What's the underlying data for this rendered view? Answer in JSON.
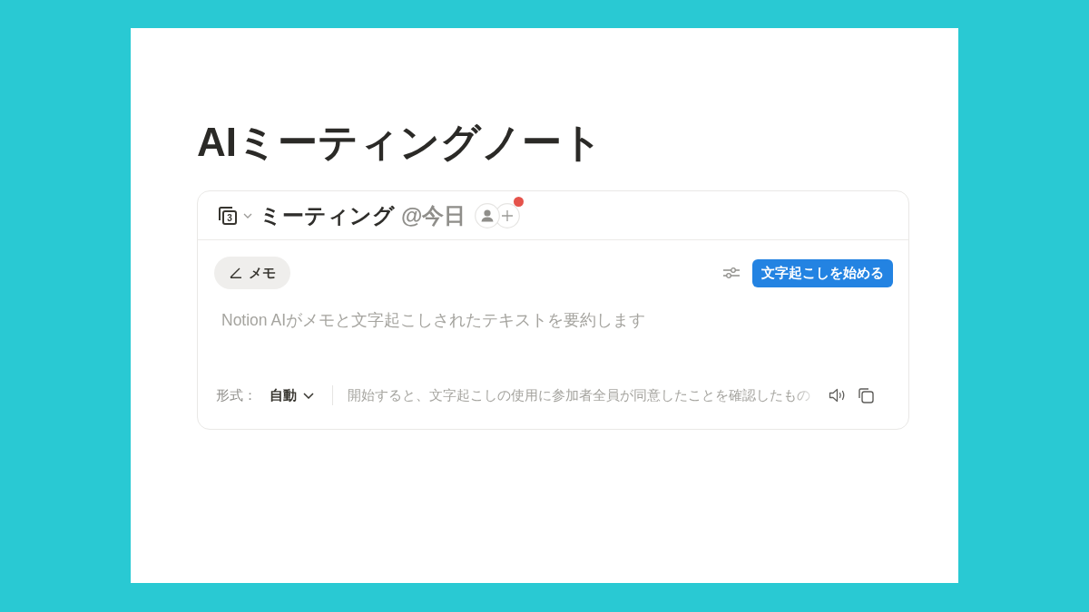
{
  "page_title": "AIミーティングノート",
  "meeting_block": {
    "header": {
      "calendar_day": "3",
      "title": "ミーティング",
      "date_mention": "@今日",
      "invite_notification": true
    },
    "memo_button": {
      "label": "メモ"
    },
    "transcribe_button": {
      "label": "文字起こしを始める"
    },
    "summary_field": {
      "placeholder": "Notion AIがメモと文字起こしされたテキストを要約します"
    },
    "footer": {
      "format_label": "形式：",
      "format_value": "自動",
      "consent_notice": "開始すると、文字起こしの使用に参加者全員が同意したことを確認したもの"
    }
  }
}
